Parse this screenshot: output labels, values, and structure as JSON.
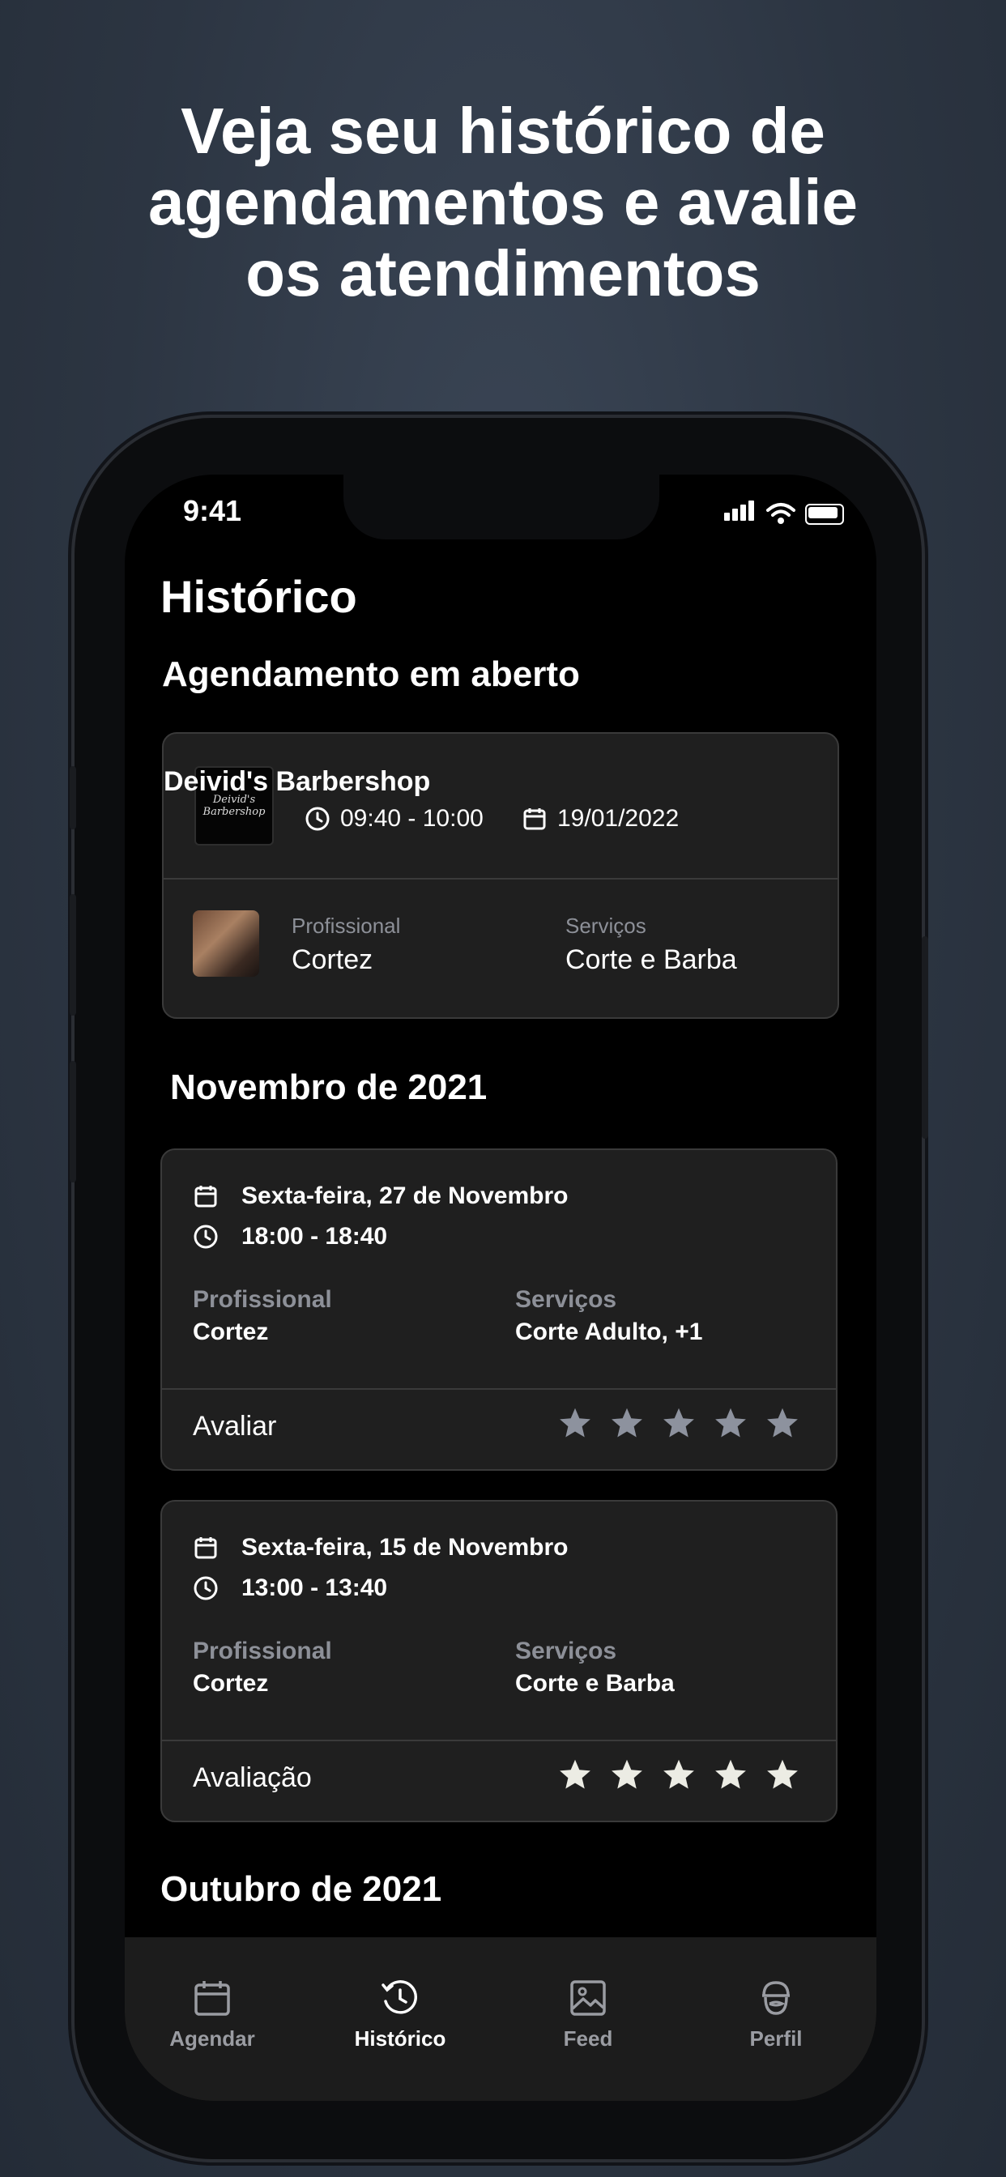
{
  "headline": {
    "line1": "Veja seu histórico de",
    "line2": "agendamentos e avalie",
    "line3": "os atendimentos"
  },
  "status_bar": {
    "time": "9:41"
  },
  "page_title": "Histórico",
  "open_booking": {
    "section_title": "Agendamento em aberto",
    "shop_name": "Deivid's Barbershop",
    "logo_text": "Deivid's Barbershop",
    "time_range": "09:40 - 10:00",
    "date": "19/01/2022",
    "professional_label": "Profissional",
    "professional_value": "Cortez",
    "services_label": "Serviços",
    "services_value": "Corte e Barba"
  },
  "months": [
    {
      "title": "Novembro de 2021",
      "items": [
        {
          "date": "Sexta-feira, 27 de Novembro",
          "time": "18:00 - 18:40",
          "professional_label": "Profissional",
          "professional_value": "Cortez",
          "services_label": "Serviços",
          "services_value": "Corte Adulto, +1",
          "rating_label": "Avaliar",
          "rating": 0,
          "max_rating": 5
        },
        {
          "date": "Sexta-feira, 15 de Novembro",
          "time": "13:00 - 13:40",
          "professional_label": "Profissional",
          "professional_value": "Cortez",
          "services_label": "Serviços",
          "services_value": "Corte e Barba",
          "rating_label": "Avaliação",
          "rating": 5,
          "max_rating": 5
        }
      ]
    },
    {
      "title": "Outubro de 2021"
    }
  ],
  "tabbar": {
    "items": [
      {
        "label": "Agendar",
        "icon": "calendar-icon"
      },
      {
        "label": "Histórico",
        "icon": "history-icon",
        "active": true
      },
      {
        "label": "Feed",
        "icon": "image-icon"
      },
      {
        "label": "Perfil",
        "icon": "profile-icon"
      }
    ]
  },
  "colors": {
    "star_filled": "#ecece4",
    "star_empty": "#8d929e",
    "card_bg": "#1f1f1f",
    "card_border": "#3a3a3a"
  }
}
